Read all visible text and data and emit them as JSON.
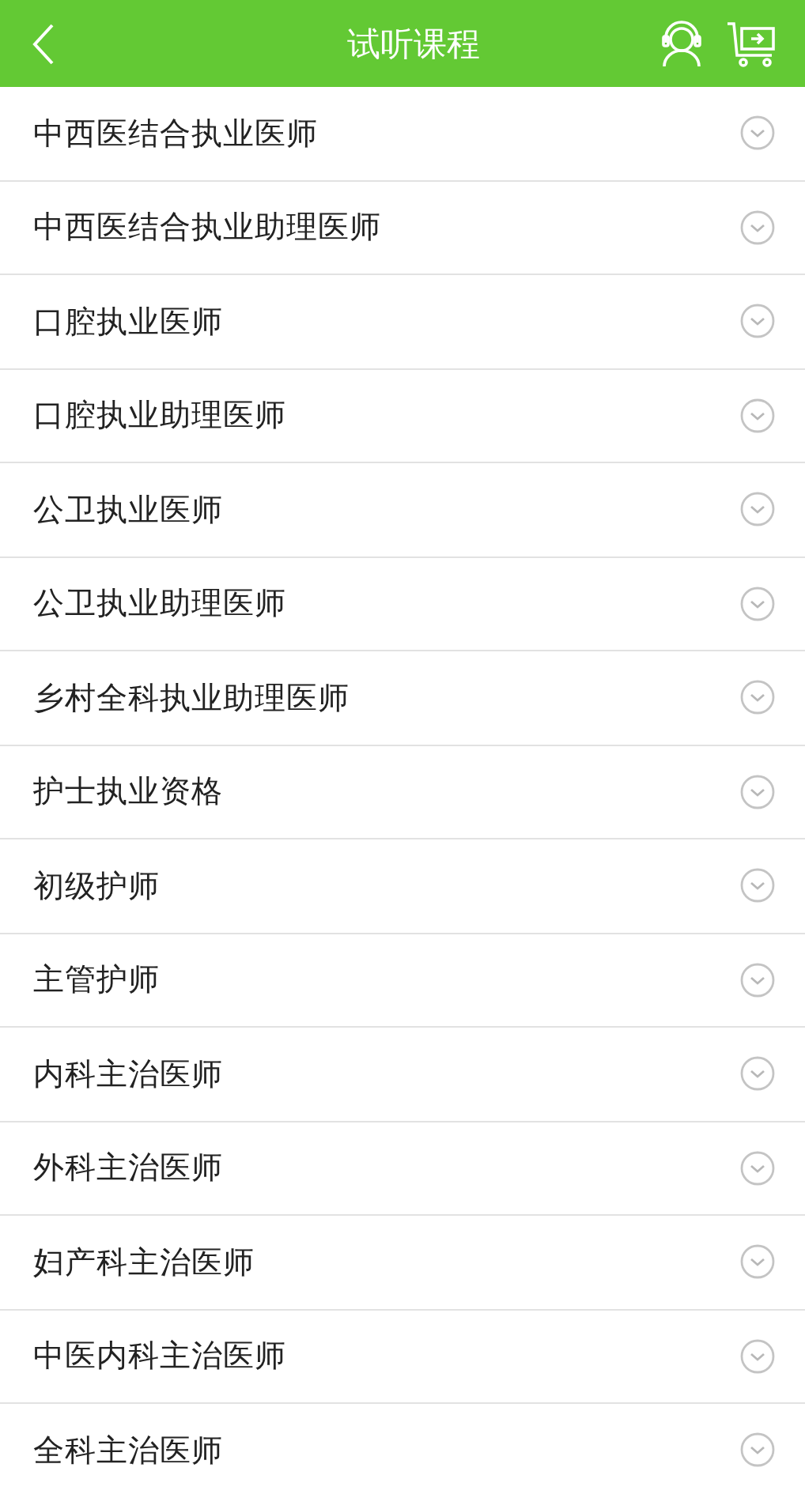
{
  "header": {
    "title": "试听课程"
  },
  "courses": [
    {
      "name": "中西医结合执业医师",
      "expanded": false
    },
    {
      "name": "中西医结合执业助理医师",
      "expanded": false
    },
    {
      "name": "口腔执业医师",
      "expanded": false
    },
    {
      "name": "口腔执业助理医师",
      "expanded": false
    },
    {
      "name": "公卫执业医师",
      "expanded": false
    },
    {
      "name": "公卫执业助理医师",
      "expanded": false
    },
    {
      "name": "乡村全科执业助理医师",
      "expanded": false
    },
    {
      "name": "护士执业资格",
      "expanded": false
    },
    {
      "name": "初级护师",
      "expanded": false
    },
    {
      "name": "主管护师",
      "expanded": false
    },
    {
      "name": "内科主治医师",
      "expanded": false
    },
    {
      "name": "外科主治医师",
      "expanded": false
    },
    {
      "name": "妇产科主治医师",
      "expanded": false
    },
    {
      "name": "中医内科主治医师",
      "expanded": false
    },
    {
      "name": "全科主治医师",
      "expanded": false
    }
  ]
}
